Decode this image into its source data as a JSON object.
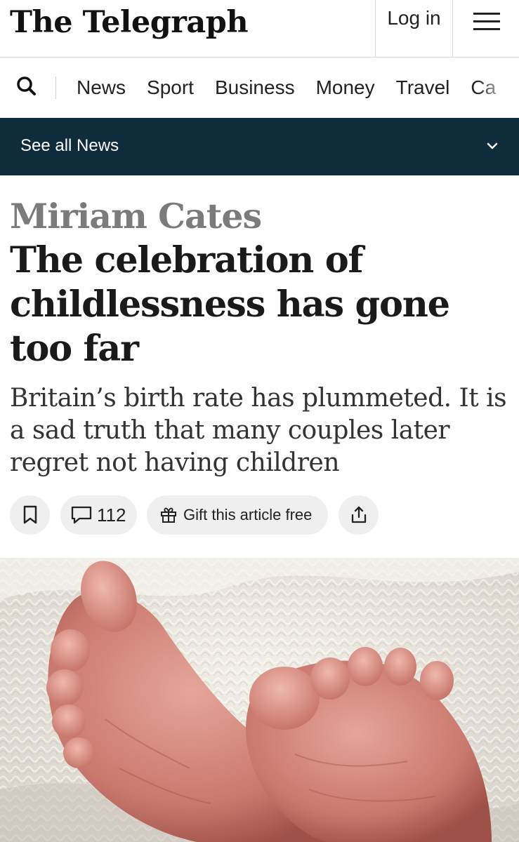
{
  "header": {
    "logo": "The Telegraph",
    "login_label": "Log in",
    "menu_icon": "hamburger-icon"
  },
  "nav": {
    "search_icon": "search-icon",
    "items": [
      "News",
      "Sport",
      "Business",
      "Money",
      "Travel",
      "Ca"
    ]
  },
  "section_bar": {
    "label": "See all News",
    "icon": "chevron-down-icon"
  },
  "article": {
    "author": "Miriam Cates",
    "headline": "The celebration of childlessness has gone too far",
    "standfirst": "Britain’s birth rate has plummeted. It is a sad truth that many couples later regret not having children",
    "comment_count": "112",
    "gift_label": "Gift this article free",
    "image_alt": "Baby feet on a white knitted blanket"
  },
  "colors": {
    "section_bar": "#0f2c3c",
    "author": "#7b7b7b",
    "pill_bg": "#efefef"
  }
}
